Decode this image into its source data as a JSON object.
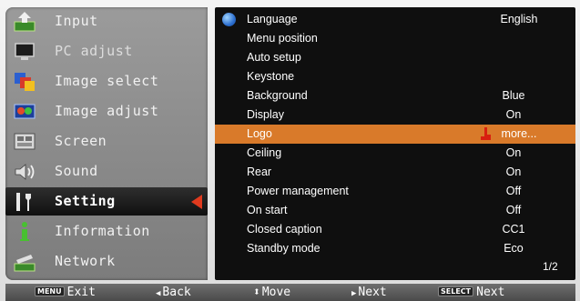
{
  "left_menu": {
    "items": [
      {
        "label": "Input",
        "icon": "input-icon"
      },
      {
        "label": "PC adjust",
        "icon": "pc-adjust-icon"
      },
      {
        "label": "Image select",
        "icon": "image-select-icon"
      },
      {
        "label": "Image adjust",
        "icon": "image-adjust-icon"
      },
      {
        "label": "Screen",
        "icon": "screen-icon"
      },
      {
        "label": "Sound",
        "icon": "sound-icon"
      },
      {
        "label": "Setting",
        "icon": "setting-icon"
      },
      {
        "label": "Information",
        "icon": "information-icon"
      },
      {
        "label": "Network",
        "icon": "network-icon"
      }
    ],
    "active": "Setting"
  },
  "settings": {
    "rows": [
      {
        "name": "Language",
        "value": "English"
      },
      {
        "name": "Menu position",
        "value": ""
      },
      {
        "name": "Auto setup",
        "value": ""
      },
      {
        "name": "Keystone",
        "value": ""
      },
      {
        "name": "Background",
        "value": "Blue"
      },
      {
        "name": "Display",
        "value": "On"
      },
      {
        "name": "Logo",
        "value": "more..."
      },
      {
        "name": "Ceiling",
        "value": "On"
      },
      {
        "name": "Rear",
        "value": "On"
      },
      {
        "name": "Power management",
        "value": "Off"
      },
      {
        "name": "On start",
        "value": "Off"
      },
      {
        "name": "Closed caption",
        "value": "CC1"
      },
      {
        "name": "Standby mode",
        "value": "Eco"
      }
    ],
    "selected": "Logo",
    "page": "1/2"
  },
  "bottom_bar": {
    "exit_key": "MENU",
    "exit_label": "Exit",
    "back_symbol": "◀",
    "back_label": "Back",
    "move_symbol": "⬍",
    "move_label": "Move",
    "next_symbol": "▶",
    "next_label": "Next",
    "select_key": "SELECT",
    "select_label": "Next"
  },
  "colors": {
    "highlight": "#d97a2a",
    "pointer": "#e03a1e",
    "panel": "#0f0f0f"
  }
}
